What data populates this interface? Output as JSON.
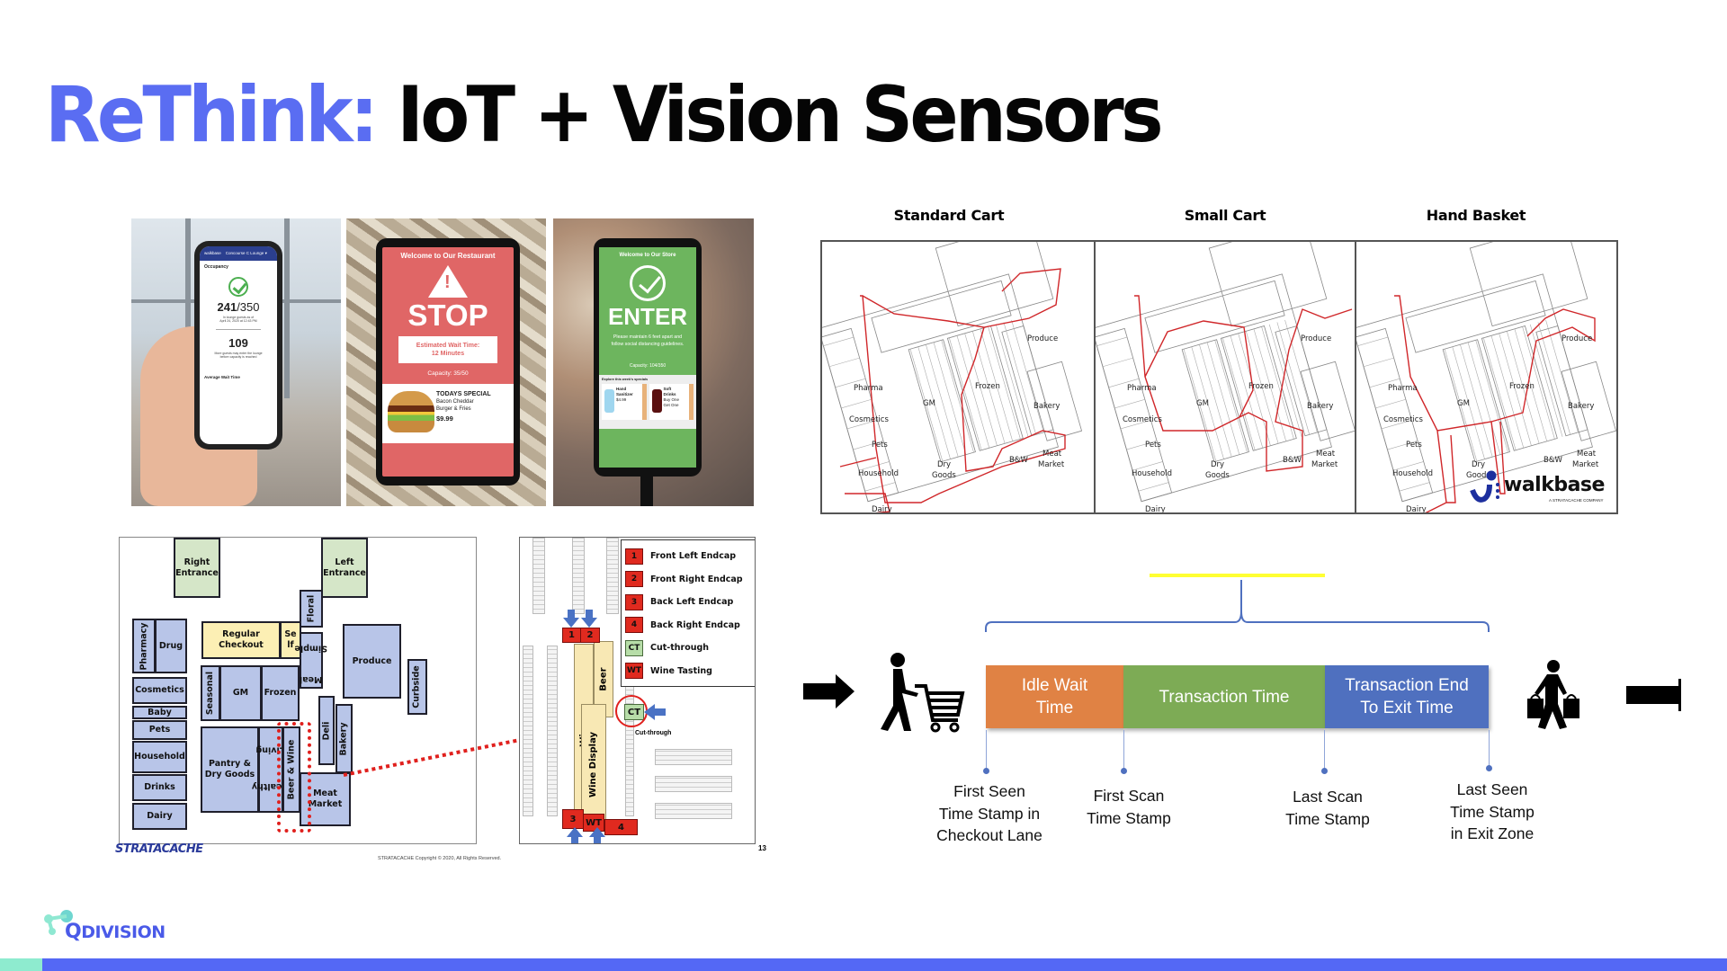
{
  "title": {
    "accent": "ReThink:",
    "rest": " IoT + Vision Sensors"
  },
  "colors": {
    "accent": "#5A6DF2",
    "idle": "#E08244",
    "transaction": "#7DAB55",
    "exit": "#4F70BF",
    "footer_teal": "#8EEBCF",
    "footer_blue": "#5468F5",
    "route_red": "#E0201D",
    "bracket_yellow": "#FFFF33"
  },
  "photos": {
    "phone": {
      "header_left": "walkbase",
      "header_right": "Concourse C Lounge",
      "section": "Occupancy",
      "occupancy": "241",
      "capacity": "/350",
      "sub1": "In lounge guests as of",
      "sub2": "April 24, 2020 at 12:43 PM",
      "remaining": "109",
      "remaining_sub1": "More guests may enter the lounge",
      "remaining_sub2": "before capacity is reached",
      "footer": "Average Wait Time"
    },
    "stop": {
      "welcome": "Welcome to Our Restaurant",
      "word": "STOP",
      "wait_label": "Estimated Wait Time:",
      "wait_value": "12 Minutes",
      "capacity": "Capacity: 35/50",
      "special_title": "TODAYS SPECIAL",
      "special_line1": "Bacon Cheddar",
      "special_line2": "Burger & Fries",
      "special_price": "$9.99"
    },
    "enter": {
      "welcome": "Welcome to Our Store",
      "word": "ENTER",
      "msg1": "Please maintain 6 feet apart and",
      "msg2": "follow social distancing guidelines.",
      "capacity": "Capacity: 104/350",
      "specials_label": "Explore this week's specials",
      "card1_title1": "Hand",
      "card1_title2": "Sanitizer",
      "card1_price": "$4.99",
      "card2_title1": "Soft",
      "card2_title2": "Drinks",
      "card2_offer1": "Buy One",
      "card2_offer2": "Get One"
    }
  },
  "heatmaps": {
    "titles": [
      "Standard Cart",
      "Small Cart",
      "Hand Basket"
    ],
    "labels": {
      "produce": "Produce",
      "pharma": "Pharma",
      "gm": "GM",
      "frozen": "Frozen",
      "bakery": "Bakery",
      "cosmetics": "Cosmetics",
      "pets": "Pets",
      "dry": "Dry",
      "goods": "Goods",
      "bw": "B&W",
      "meat": "Meat",
      "market": "Market",
      "household": "Household",
      "dairy": "Dairy"
    },
    "logo": {
      "name": "walkbase",
      "tagline": "A STRATACACHE COMPANY"
    }
  },
  "floorplan": {
    "zones": {
      "right_entrance1": "Right",
      "right_entrance2": "Entrance",
      "left_entrance1": "Left",
      "left_entrance2": "Entrance",
      "regular_checkout1": "Regular",
      "regular_checkout2": "Checkout",
      "self1": "Se",
      "self2": "lf",
      "floral": "Floral",
      "pharmacy": "Pharmacy",
      "drug": "Drug",
      "meal1": "Meal",
      "meal2": "Simple",
      "produce": "Produce",
      "curbside": "Curbside",
      "seasonal": "Seasonal",
      "gm": "GM",
      "frozen": "Frozen",
      "cosmetics": "Cosmetics",
      "baby": "Baby",
      "pets": "Pets",
      "deli": "Deli",
      "bakery": "Bakery",
      "household": "Household",
      "pantry1": "Pantry &",
      "pantry2": "Dry Goods",
      "healthy": "Healthy",
      "living": "Living",
      "beer_wine": "Beer & Wine",
      "meat1": "Meat",
      "meat2": "Market",
      "drinks": "Drinks",
      "dairy": "Dairy"
    },
    "brand": "STRATACACHE",
    "copyright": "STRATACACHE Copyright © 2020, All Rights Reserved.",
    "page_number": "13"
  },
  "detail_plan": {
    "legend": [
      {
        "key": "1",
        "label": "Front Left Endcap"
      },
      {
        "key": "2",
        "label": "Front Right Endcap"
      },
      {
        "key": "3",
        "label": "Back Left Endcap"
      },
      {
        "key": "4",
        "label": "Back Right Endcap"
      },
      {
        "key": "CT",
        "label": "Cut-through"
      },
      {
        "key": "WT",
        "label": "Wine Tasting"
      }
    ],
    "wine": "Wine",
    "beer": "Beer",
    "wine_display": "Wine Display",
    "cut_through_label": "Cut-through"
  },
  "timeline": {
    "segments": [
      {
        "line1": "Idle Wait",
        "line2": "Time"
      },
      {
        "line1": "Transaction Time",
        "line2": ""
      },
      {
        "line1": "Transaction End",
        "line2": "To Exit Time"
      }
    ],
    "markers": [
      {
        "lines": [
          "First Seen",
          "Time Stamp in",
          "Checkout Lane"
        ]
      },
      {
        "lines": [
          "First Scan",
          "Time Stamp"
        ]
      },
      {
        "lines": [
          "Last Scan",
          "Time Stamp"
        ]
      },
      {
        "lines": [
          "Last Seen",
          "Time Stamp",
          "in Exit Zone"
        ]
      }
    ]
  },
  "footer": {
    "logo_q": "Q",
    "logo_rest": "DIVISION"
  }
}
